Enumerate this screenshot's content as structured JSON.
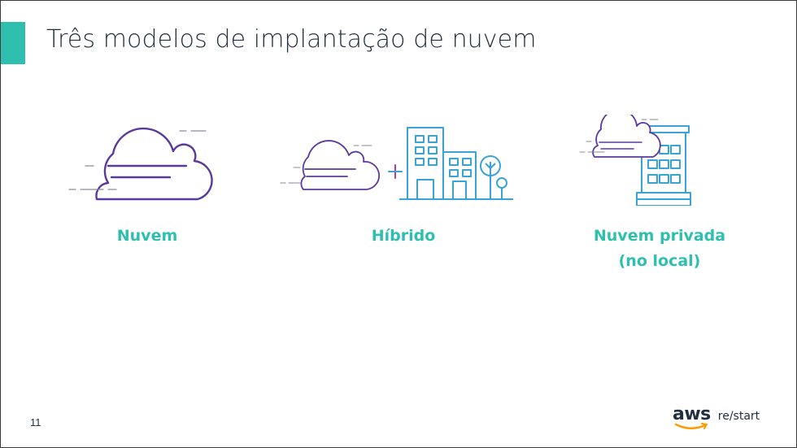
{
  "slide": {
    "title": "Três modelos de implantação de nuvem",
    "page_number": "11"
  },
  "models": [
    {
      "label": "Nuvem",
      "icon": "cloud-icon"
    },
    {
      "label": "Híbrido",
      "icon": "hybrid-cloud-building-icon"
    },
    {
      "label_line1": "Nuvem privada",
      "label_line2": "(no local)",
      "icon": "private-cloud-building-icon"
    }
  ],
  "logo": {
    "brand": "aws",
    "product": "re/start"
  },
  "colors": {
    "accent": "#2fbfae",
    "cloud_purple": "#5a3a9e",
    "building_blue": "#3aa3d6",
    "text_dark": "#232f3e"
  }
}
